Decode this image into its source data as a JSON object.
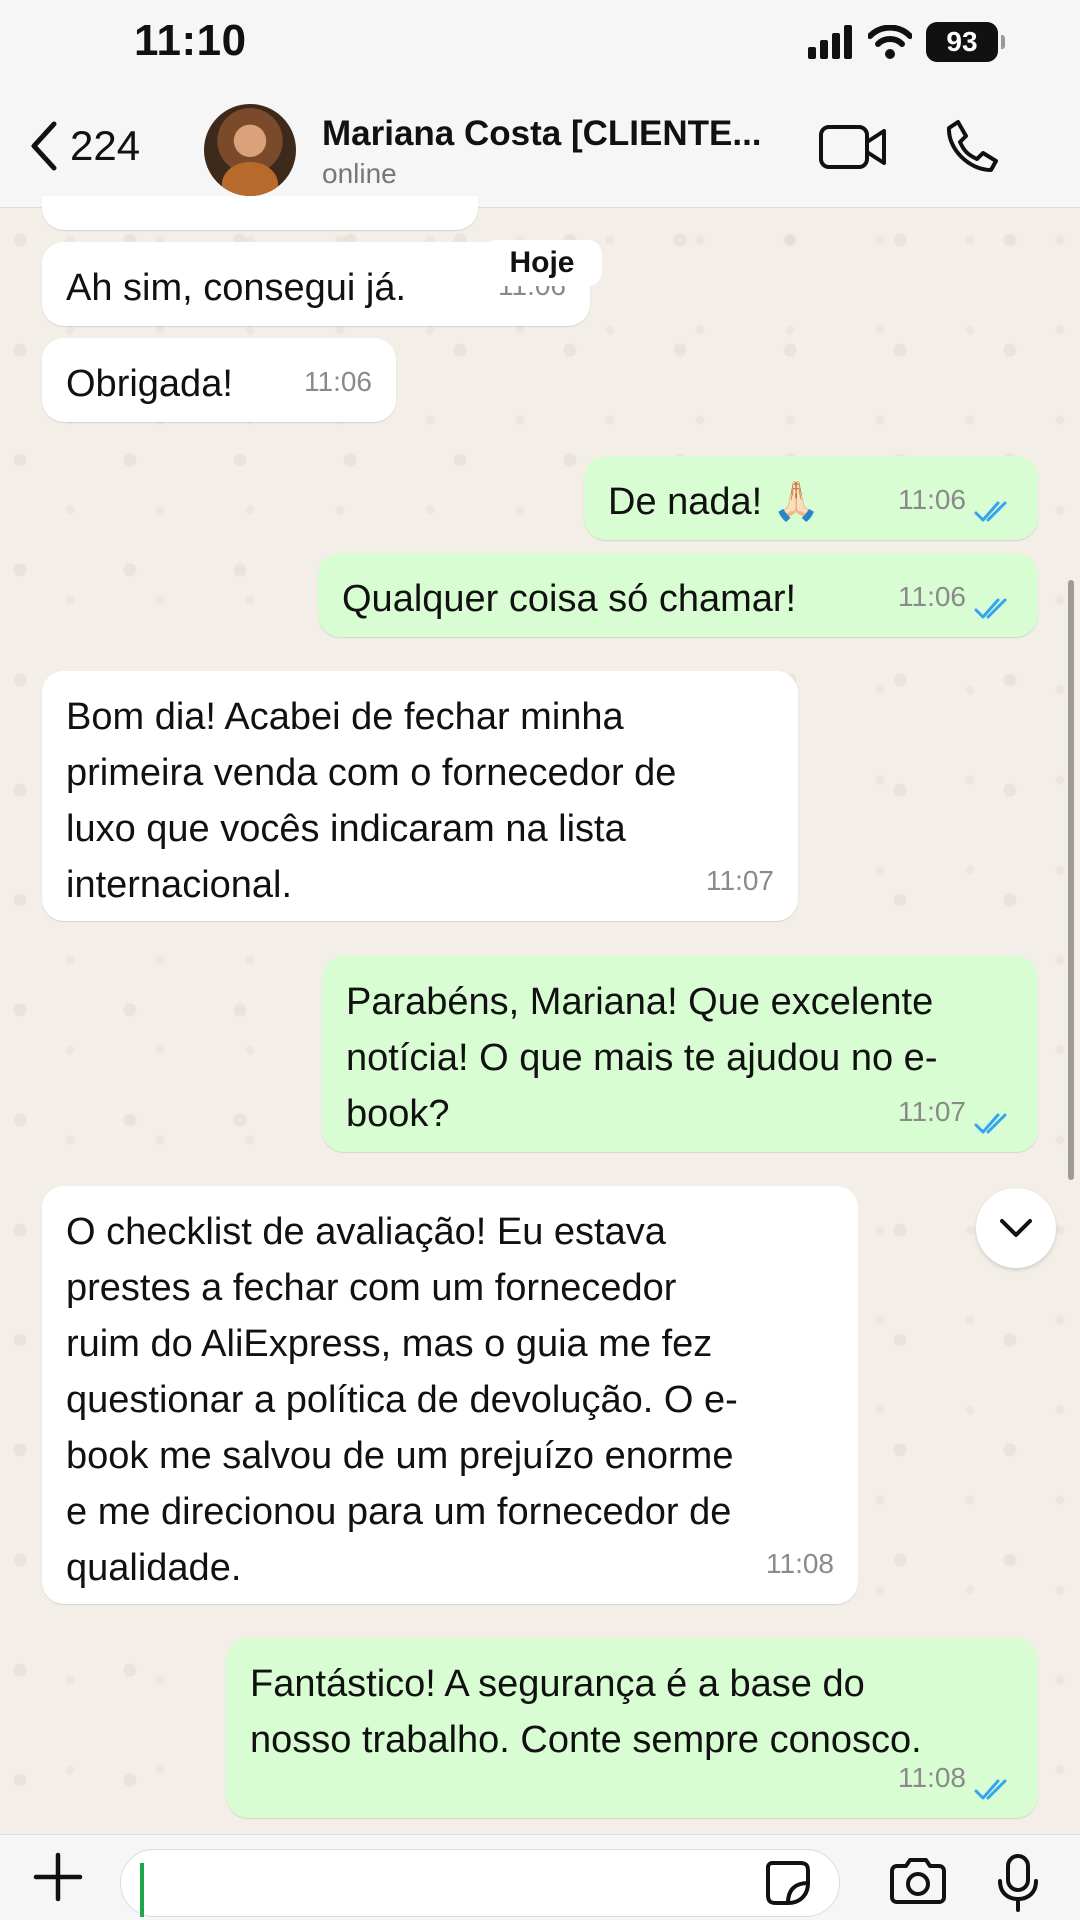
{
  "status_bar": {
    "time": "11:10",
    "battery": "93"
  },
  "header": {
    "back_count": "224",
    "contact_name": "Mariana Costa [CLIENTE...",
    "contact_status": "online"
  },
  "date_label": "Hoje",
  "messages": [
    {
      "direction": "in",
      "text": "Ah sim, consegui já.",
      "time": "11:06"
    },
    {
      "direction": "in",
      "text": "Obrigada!",
      "time": "11:06"
    },
    {
      "direction": "out",
      "text": "De nada! 🙏🏻",
      "time": "11:06",
      "read": true
    },
    {
      "direction": "out",
      "text": "Qualquer coisa só chamar!",
      "time": "11:06",
      "read": true
    },
    {
      "direction": "in",
      "text": "Bom dia! Acabei de fechar minha\nprimeira venda com o fornecedor de\nluxo que vocês indicaram na lista\ninternacional.",
      "time": "11:07"
    },
    {
      "direction": "out",
      "text": "Parabéns, Mariana! Que excelente\nnotícia! O que mais te ajudou no e-\nbook?",
      "time": "11:07",
      "read": true
    },
    {
      "direction": "in",
      "text": "O checklist de avaliação! Eu estava\nprestes a fechar com um fornecedor\nruim do AliExpress, mas o guia me fez\nquestionar a política de devolução. O e-\nbook me salvou de um prejuízo enorme\ne me direcionou para um fornecedor de\nqualidade.",
      "time": "11:08"
    },
    {
      "direction": "out",
      "text": "Fantástico! A segurança é a base do\nnosso trabalho. Conte sempre conosco.",
      "time": "11:08",
      "read": true
    }
  ],
  "colors": {
    "incoming": "#ffffff",
    "outgoing": "#d9fdd3",
    "read_ticks": "#34a3f1",
    "cursor": "#1ba84b"
  },
  "input": {
    "value": "",
    "placeholder": ""
  }
}
